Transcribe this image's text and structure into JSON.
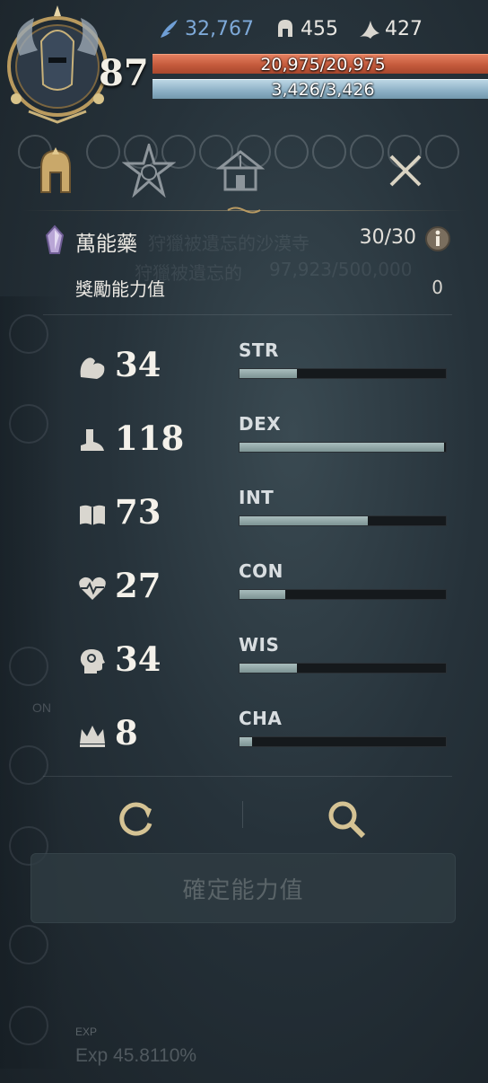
{
  "header": {
    "level": "87",
    "resources": [
      {
        "icon": "feather-icon",
        "value": "32,767",
        "color": "#7ea9d8"
      },
      {
        "icon": "helmet-icon",
        "value": "455",
        "color": "#e9e7e2"
      },
      {
        "icon": "wing-icon",
        "value": "427",
        "color": "#e9e7e2"
      }
    ],
    "hp_text": "20,975/20,975",
    "hp_fraction": 1.0,
    "mp_text": "3,426/3,426",
    "mp_fraction": 1.0
  },
  "background_text": {
    "line1": "狩獵被遺忘的沙漠寺",
    "line2": "狩獵被遺忘的",
    "line3": "97,923/500,000"
  },
  "tabs": [
    {
      "icon": "helmet-tab-icon",
      "active": true
    },
    {
      "icon": "star-badge-icon",
      "active": false
    },
    {
      "icon": "shrine-icon",
      "active": false
    },
    {
      "icon": "close-icon",
      "active": false
    }
  ],
  "panel": {
    "potion_label": "萬能藥",
    "potion_value": "30/30",
    "bonus_label": "獎勵能力值",
    "bonus_value": "0"
  },
  "stats": [
    {
      "icon": "arm-icon",
      "value": "34",
      "name": "STR",
      "fill": 0.28
    },
    {
      "icon": "boot-icon",
      "value": "118",
      "name": "DEX",
      "fill": 0.99
    },
    {
      "icon": "book-icon",
      "value": "73",
      "name": "INT",
      "fill": 0.62
    },
    {
      "icon": "heart-pulse-icon",
      "value": "27",
      "name": "CON",
      "fill": 0.22
    },
    {
      "icon": "head-icon",
      "value": "34",
      "name": "WIS",
      "fill": 0.28
    },
    {
      "icon": "crown-icon",
      "value": "8",
      "name": "CHA",
      "fill": 0.06
    }
  ],
  "actions": {
    "reset_icon": "reset-icon",
    "search_icon": "magnifier-icon"
  },
  "confirm_label": "確定能力值",
  "exp": {
    "label": "EXP",
    "value": "Exp 45.8110%"
  },
  "rail": {
    "on_label": "ON"
  },
  "colors": {
    "hp": "#c45a3c",
    "mp": "#8fb2c7",
    "gold": "#c8a86a",
    "stat_fill": "#8ea5a5"
  }
}
